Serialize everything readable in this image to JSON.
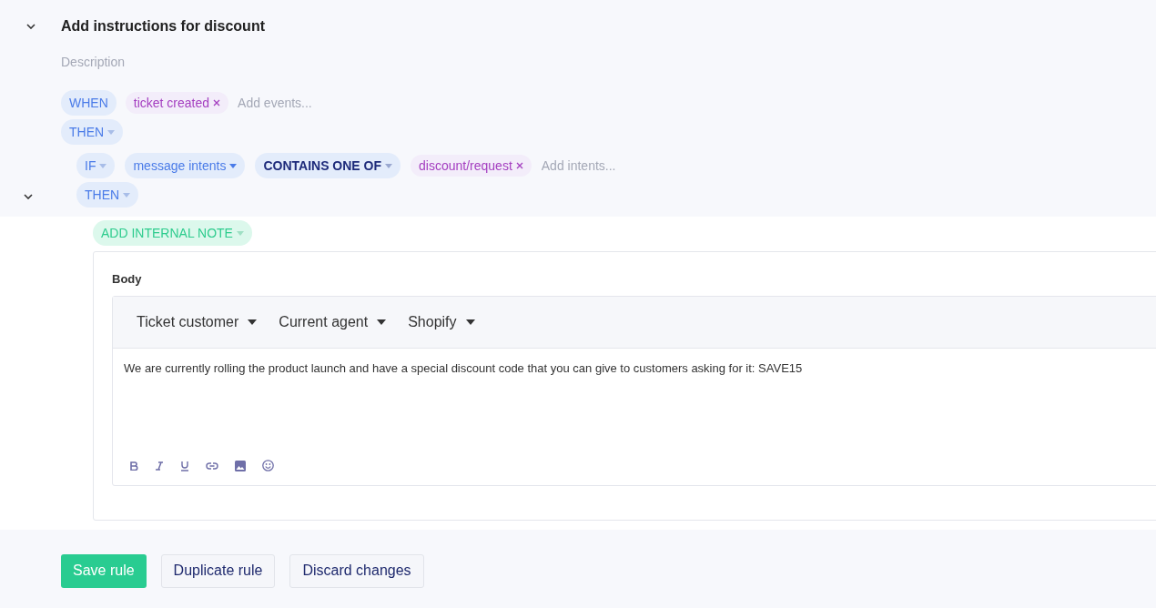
{
  "rule": {
    "title": "Add instructions for discount",
    "expanded": true,
    "description_placeholder": "Description"
  },
  "trigger": {
    "keyword": "WHEN",
    "tags": [
      {
        "label": "ticket created"
      }
    ],
    "placeholder": "Add events..."
  },
  "then": {
    "keyword": "THEN"
  },
  "condition": {
    "keyword": "IF",
    "field": "message intents",
    "operator": "CONTAINS ONE OF",
    "tags": [
      {
        "label": "discount/request"
      }
    ],
    "placeholder": "Add intents..."
  },
  "branch": {
    "keyword": "THEN",
    "expanded": true
  },
  "action": {
    "label": "ADD INTERNAL NOTE",
    "body_label": "Body",
    "variable_menus": [
      "Ticket customer",
      "Current agent",
      "Shopify"
    ],
    "value": "We are currently rolling the product launch and have a special discount code that you can give to customers asking for it: SAVE15",
    "format_tools": [
      {
        "kind": "bold"
      },
      {
        "kind": "italic"
      },
      {
        "kind": "underline"
      },
      {
        "kind": "link"
      },
      {
        "kind": "image"
      },
      {
        "kind": "emoji"
      }
    ]
  },
  "buttons": [
    {
      "label": "Save rule",
      "kind": "primary"
    },
    {
      "label": "Duplicate rule",
      "kind": "secondary"
    },
    {
      "label": "Discard changes",
      "kind": "secondary"
    }
  ]
}
